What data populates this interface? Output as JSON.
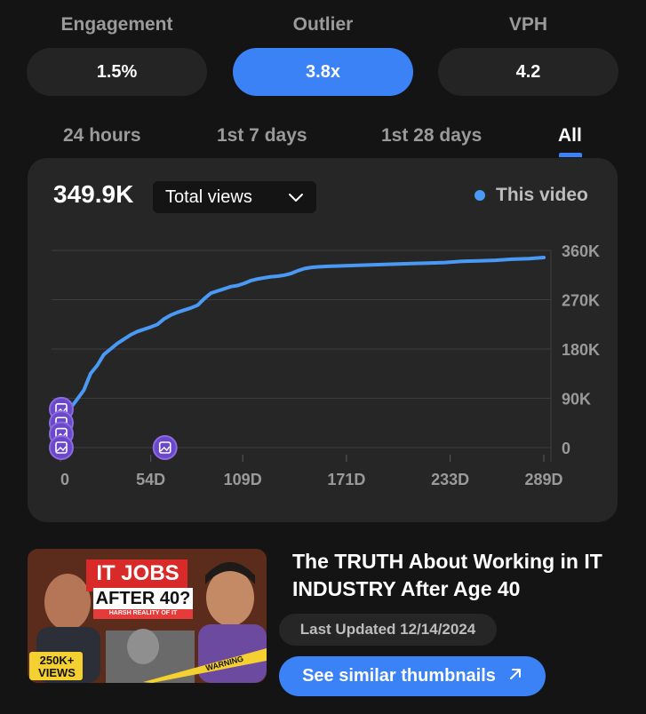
{
  "metrics": [
    {
      "label": "Engagement",
      "value": "1.5%"
    },
    {
      "label": "Outlier",
      "value": "3.8x"
    },
    {
      "label": "VPH",
      "value": "4.2"
    }
  ],
  "tabs": [
    "24 hours",
    "1st 7 days",
    "1st 28 days",
    "All"
  ],
  "active_tab": "All",
  "chart_header": {
    "value": "349.9K",
    "metric_select": "Total views",
    "legend_label": "This video",
    "accent": "#4a9af5"
  },
  "chart_data": {
    "type": "line",
    "x_tick_labels": [
      "0",
      "54D",
      "109D",
      "171D",
      "233D",
      "289D"
    ],
    "y_tick_labels": [
      "360K",
      "270K",
      "180K",
      "90K",
      "0"
    ],
    "ylim": [
      0,
      360000
    ],
    "xlim_days": [
      0,
      289
    ],
    "series": [
      {
        "name": "This video",
        "color": "#4a9af5",
        "x": [
          0,
          2,
          6,
          10,
          14,
          18,
          22,
          26,
          30,
          34,
          38,
          42,
          46,
          50,
          54,
          58,
          62,
          66,
          70,
          74,
          78,
          82,
          86,
          90,
          94,
          98,
          102,
          106,
          110,
          114,
          118,
          122,
          126,
          130,
          134,
          138,
          142,
          146,
          150,
          154,
          160,
          170,
          180,
          190,
          200,
          210,
          220,
          230,
          240,
          250,
          260,
          270,
          280,
          289
        ],
        "y": [
          50000,
          60000,
          72000,
          88000,
          105000,
          135000,
          150000,
          170000,
          180000,
          190000,
          198000,
          206000,
          212000,
          216000,
          220000,
          225000,
          235000,
          242000,
          247000,
          251000,
          255000,
          260000,
          272000,
          282000,
          286000,
          290000,
          294000,
          296000,
          300000,
          305000,
          308000,
          310000,
          312000,
          313000,
          315000,
          318000,
          323000,
          327000,
          329000,
          330000,
          331000,
          332000,
          333000,
          334000,
          335000,
          336000,
          337000,
          338000,
          340000,
          341000,
          342000,
          344000,
          345000,
          347000
        ]
      }
    ],
    "markers": [
      {
        "x": 0,
        "y": 70000,
        "icon": "image-icon"
      },
      {
        "x": 0,
        "y": 45000,
        "icon": "image-icon"
      },
      {
        "x": 0,
        "y": 25000,
        "icon": "image-icon"
      },
      {
        "x": 0,
        "y": 0,
        "icon": "image-icon"
      },
      {
        "x": 62,
        "y": 0,
        "icon": "image-icon"
      }
    ],
    "grid": true
  },
  "video": {
    "title": "The TRUTH About Working in IT INDUSTRY After Age 40",
    "last_updated": "Last Updated 12/14/2024",
    "similar_label": "See similar thumbnails",
    "thumbnail": {
      "headline_1": "IT JOBS",
      "headline_2": "AFTER 40?",
      "tagline": "HARSH REALITY OF IT",
      "badge_1": "250K+",
      "badge_2": "VIEWS",
      "tape": "WARNING"
    }
  }
}
